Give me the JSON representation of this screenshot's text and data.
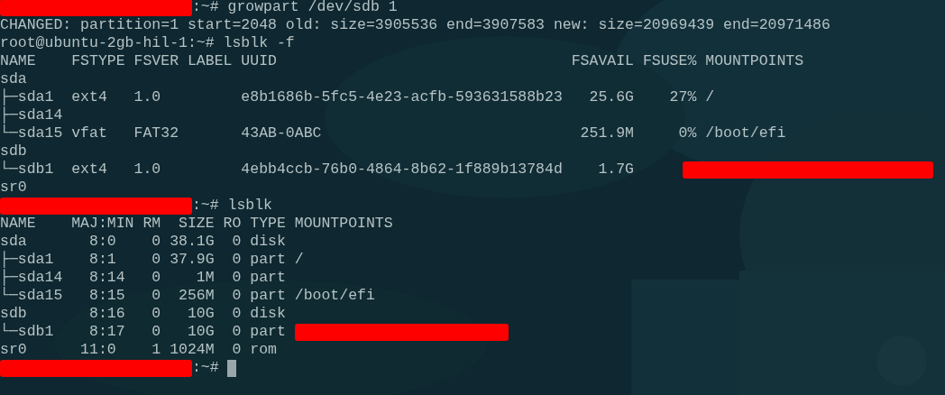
{
  "lines": [
    {
      "parts": [
        {
          "kind": "prompt_redaction"
        },
        {
          "kind": "text",
          "text": ":~# growpart /dev/sdb 1"
        }
      ]
    },
    {
      "parts": [
        {
          "kind": "text",
          "text": "CHANGED: partition=1 start=2048 old: size=3905536 end=3907583 new: size=20969439 end=20971486"
        }
      ]
    },
    {
      "parts": [
        {
          "kind": "text",
          "text": "root@ubuntu-2gb-hil-1:~# lsblk -f"
        }
      ]
    },
    {
      "parts": [
        {
          "kind": "text",
          "text": "NAME    FSTYPE FSVER LABEL UUID                                 FSAVAIL FSUSE% MOUNTPOINTS"
        }
      ]
    },
    {
      "parts": [
        {
          "kind": "text",
          "text": "sda"
        }
      ]
    },
    {
      "parts": [
        {
          "kind": "text",
          "text": "├─sda1  ext4   1.0         e8b1686b-5fc5-4e23-acfb-593631588b23   25.6G    27% /"
        }
      ]
    },
    {
      "parts": [
        {
          "kind": "text",
          "text": "├─sda14"
        }
      ]
    },
    {
      "parts": [
        {
          "kind": "text",
          "text": "└─sda15 vfat   FAT32       43AB-0ABC                             251.9M     0% /boot/efi"
        }
      ]
    },
    {
      "parts": [
        {
          "kind": "text",
          "text": "sdb"
        }
      ]
    },
    {
      "parts": [
        {
          "kind": "text",
          "text": "└─sdb1  ext4   1.0         4ebb4ccb-76b0-4864-8b62-1f889b13784d    1.7G"
        },
        {
          "kind": "field_redaction",
          "wide": true
        }
      ]
    },
    {
      "parts": [
        {
          "kind": "text",
          "text": "sr0"
        }
      ]
    },
    {
      "parts": [
        {
          "kind": "prompt_redaction"
        },
        {
          "kind": "text",
          "text": ":~# lsblk"
        }
      ]
    },
    {
      "parts": [
        {
          "kind": "text",
          "text": "NAME    MAJ:MIN RM  SIZE RO TYPE MOUNTPOINTS"
        }
      ]
    },
    {
      "parts": [
        {
          "kind": "text",
          "text": "sda       8:0    0 38.1G  0 disk"
        }
      ]
    },
    {
      "parts": [
        {
          "kind": "text",
          "text": "├─sda1    8:1    0 37.9G  0 part /"
        }
      ]
    },
    {
      "parts": [
        {
          "kind": "text",
          "text": "├─sda14   8:14   0    1M  0 part"
        }
      ]
    },
    {
      "parts": [
        {
          "kind": "text",
          "text": "└─sda15   8:15   0  256M  0 part /boot/efi"
        }
      ]
    },
    {
      "parts": [
        {
          "kind": "text",
          "text": "sdb       8:16   0   10G  0 disk"
        }
      ]
    },
    {
      "parts": [
        {
          "kind": "text",
          "text": "└─sdb1    8:17   0   10G  0 part"
        },
        {
          "kind": "field_redaction",
          "wide": false
        }
      ]
    },
    {
      "parts": [
        {
          "kind": "text",
          "text": "sr0      11:0    1 1024M  0 rom"
        }
      ]
    },
    {
      "parts": [
        {
          "kind": "prompt_redaction"
        },
        {
          "kind": "text",
          "text": ":~#"
        },
        {
          "kind": "cursor"
        }
      ]
    }
  ]
}
